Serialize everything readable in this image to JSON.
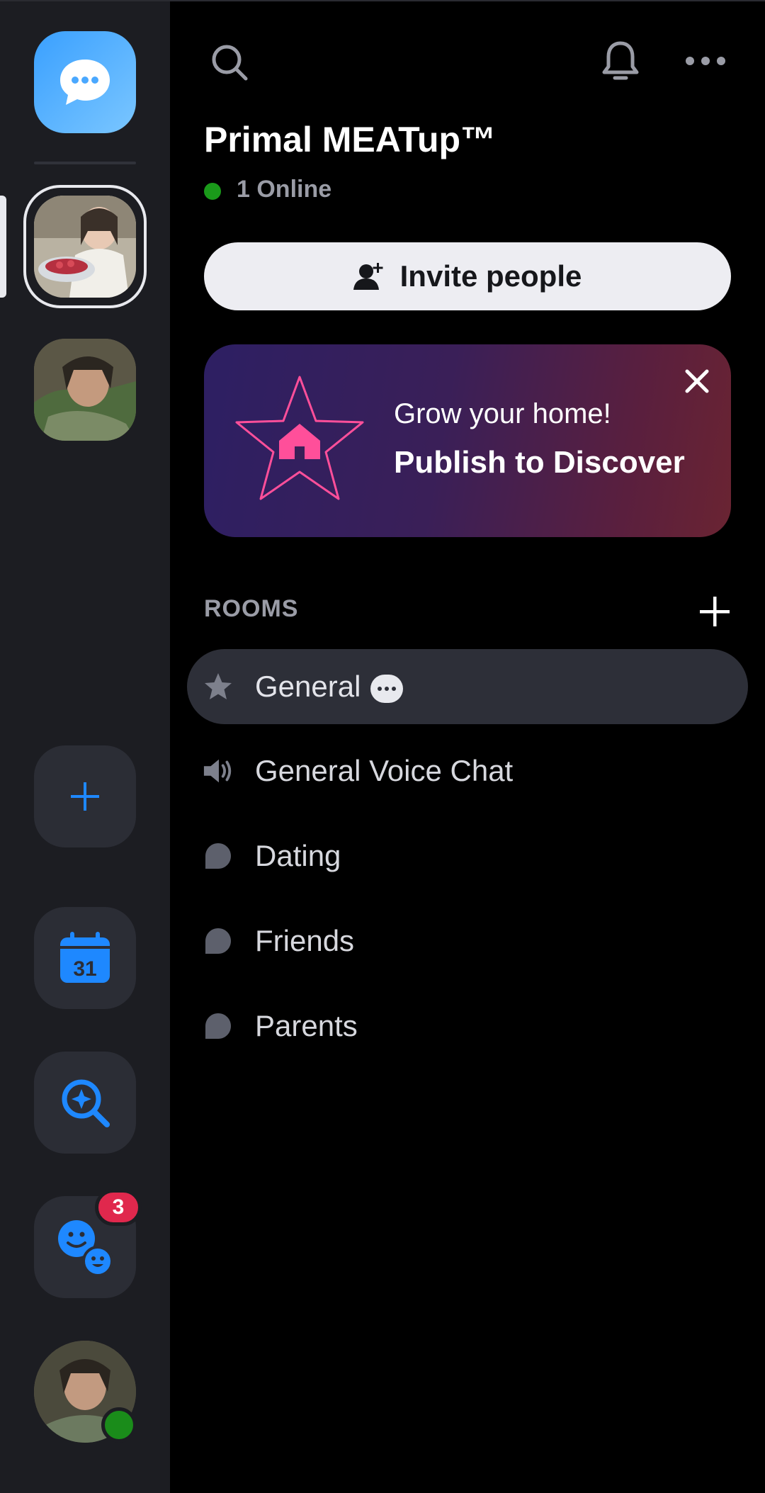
{
  "server": {
    "name": "Primal MEATup™",
    "online_text": "1 Online"
  },
  "invite": {
    "label": "Invite people"
  },
  "promo": {
    "line1": "Grow your home!",
    "line2": "Publish to Discover"
  },
  "rooms": {
    "header": "ROOMS",
    "items": [
      {
        "label": "General",
        "type": "text",
        "active": true,
        "icon": "star-icon"
      },
      {
        "label": "General Voice Chat",
        "type": "voice",
        "active": false,
        "icon": "speaker-icon"
      },
      {
        "label": "Dating",
        "type": "text",
        "active": false,
        "icon": "chat-bubble-icon"
      },
      {
        "label": "Friends",
        "type": "text",
        "active": false,
        "icon": "chat-bubble-icon"
      },
      {
        "label": "Parents",
        "type": "text",
        "active": false,
        "icon": "chat-bubble-icon"
      }
    ]
  },
  "rail": {
    "calendar_day": "31",
    "friends_badge": "3"
  },
  "colors": {
    "accent": "#1e88ff",
    "online": "#1a9a1a",
    "badge": "#e0284d",
    "promo_pink": "#ff4f9a"
  }
}
